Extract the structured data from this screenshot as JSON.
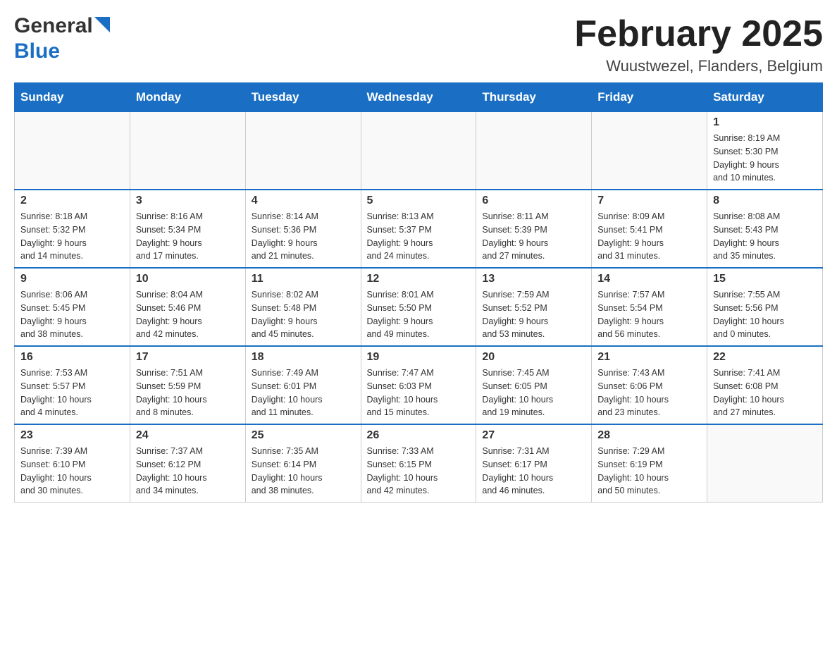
{
  "header": {
    "logo_general": "General",
    "logo_blue": "Blue",
    "title": "February 2025",
    "subtitle": "Wuustwezel, Flanders, Belgium"
  },
  "calendar": {
    "days_of_week": [
      "Sunday",
      "Monday",
      "Tuesday",
      "Wednesday",
      "Thursday",
      "Friday",
      "Saturday"
    ],
    "weeks": [
      {
        "days": [
          {
            "number": "",
            "info": ""
          },
          {
            "number": "",
            "info": ""
          },
          {
            "number": "",
            "info": ""
          },
          {
            "number": "",
            "info": ""
          },
          {
            "number": "",
            "info": ""
          },
          {
            "number": "",
            "info": ""
          },
          {
            "number": "1",
            "info": "Sunrise: 8:19 AM\nSunset: 5:30 PM\nDaylight: 9 hours\nand 10 minutes."
          }
        ]
      },
      {
        "days": [
          {
            "number": "2",
            "info": "Sunrise: 8:18 AM\nSunset: 5:32 PM\nDaylight: 9 hours\nand 14 minutes."
          },
          {
            "number": "3",
            "info": "Sunrise: 8:16 AM\nSunset: 5:34 PM\nDaylight: 9 hours\nand 17 minutes."
          },
          {
            "number": "4",
            "info": "Sunrise: 8:14 AM\nSunset: 5:36 PM\nDaylight: 9 hours\nand 21 minutes."
          },
          {
            "number": "5",
            "info": "Sunrise: 8:13 AM\nSunset: 5:37 PM\nDaylight: 9 hours\nand 24 minutes."
          },
          {
            "number": "6",
            "info": "Sunrise: 8:11 AM\nSunset: 5:39 PM\nDaylight: 9 hours\nand 27 minutes."
          },
          {
            "number": "7",
            "info": "Sunrise: 8:09 AM\nSunset: 5:41 PM\nDaylight: 9 hours\nand 31 minutes."
          },
          {
            "number": "8",
            "info": "Sunrise: 8:08 AM\nSunset: 5:43 PM\nDaylight: 9 hours\nand 35 minutes."
          }
        ]
      },
      {
        "days": [
          {
            "number": "9",
            "info": "Sunrise: 8:06 AM\nSunset: 5:45 PM\nDaylight: 9 hours\nand 38 minutes."
          },
          {
            "number": "10",
            "info": "Sunrise: 8:04 AM\nSunset: 5:46 PM\nDaylight: 9 hours\nand 42 minutes."
          },
          {
            "number": "11",
            "info": "Sunrise: 8:02 AM\nSunset: 5:48 PM\nDaylight: 9 hours\nand 45 minutes."
          },
          {
            "number": "12",
            "info": "Sunrise: 8:01 AM\nSunset: 5:50 PM\nDaylight: 9 hours\nand 49 minutes."
          },
          {
            "number": "13",
            "info": "Sunrise: 7:59 AM\nSunset: 5:52 PM\nDaylight: 9 hours\nand 53 minutes."
          },
          {
            "number": "14",
            "info": "Sunrise: 7:57 AM\nSunset: 5:54 PM\nDaylight: 9 hours\nand 56 minutes."
          },
          {
            "number": "15",
            "info": "Sunrise: 7:55 AM\nSunset: 5:56 PM\nDaylight: 10 hours\nand 0 minutes."
          }
        ]
      },
      {
        "days": [
          {
            "number": "16",
            "info": "Sunrise: 7:53 AM\nSunset: 5:57 PM\nDaylight: 10 hours\nand 4 minutes."
          },
          {
            "number": "17",
            "info": "Sunrise: 7:51 AM\nSunset: 5:59 PM\nDaylight: 10 hours\nand 8 minutes."
          },
          {
            "number": "18",
            "info": "Sunrise: 7:49 AM\nSunset: 6:01 PM\nDaylight: 10 hours\nand 11 minutes."
          },
          {
            "number": "19",
            "info": "Sunrise: 7:47 AM\nSunset: 6:03 PM\nDaylight: 10 hours\nand 15 minutes."
          },
          {
            "number": "20",
            "info": "Sunrise: 7:45 AM\nSunset: 6:05 PM\nDaylight: 10 hours\nand 19 minutes."
          },
          {
            "number": "21",
            "info": "Sunrise: 7:43 AM\nSunset: 6:06 PM\nDaylight: 10 hours\nand 23 minutes."
          },
          {
            "number": "22",
            "info": "Sunrise: 7:41 AM\nSunset: 6:08 PM\nDaylight: 10 hours\nand 27 minutes."
          }
        ]
      },
      {
        "days": [
          {
            "number": "23",
            "info": "Sunrise: 7:39 AM\nSunset: 6:10 PM\nDaylight: 10 hours\nand 30 minutes."
          },
          {
            "number": "24",
            "info": "Sunrise: 7:37 AM\nSunset: 6:12 PM\nDaylight: 10 hours\nand 34 minutes."
          },
          {
            "number": "25",
            "info": "Sunrise: 7:35 AM\nSunset: 6:14 PM\nDaylight: 10 hours\nand 38 minutes."
          },
          {
            "number": "26",
            "info": "Sunrise: 7:33 AM\nSunset: 6:15 PM\nDaylight: 10 hours\nand 42 minutes."
          },
          {
            "number": "27",
            "info": "Sunrise: 7:31 AM\nSunset: 6:17 PM\nDaylight: 10 hours\nand 46 minutes."
          },
          {
            "number": "28",
            "info": "Sunrise: 7:29 AM\nSunset: 6:19 PM\nDaylight: 10 hours\nand 50 minutes."
          },
          {
            "number": "",
            "info": ""
          }
        ]
      }
    ]
  }
}
